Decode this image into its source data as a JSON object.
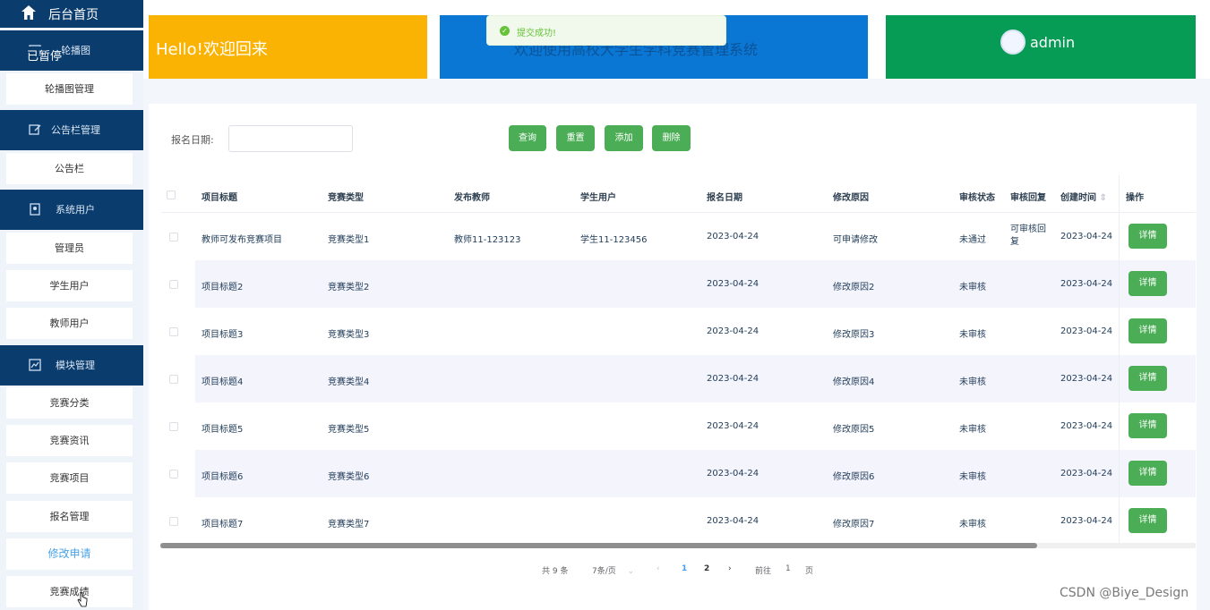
{
  "sidebar": {
    "home_label": "后台首页",
    "paused_label": "已暂停",
    "sections": [
      {
        "label": "轮播图",
        "icon": "image-icon"
      },
      {
        "label": "公告栏管理",
        "icon": "edit-icon"
      },
      {
        "label": "系统用户",
        "icon": "user-card-icon"
      },
      {
        "label": "模块管理",
        "icon": "chart-icon"
      }
    ],
    "items": [
      "轮播图管理",
      "公告栏",
      "管理员",
      "学生用户",
      "教师用户",
      "竞赛分类",
      "竞赛资讯",
      "竞赛项目",
      "报名管理",
      "修改申请",
      "竞赛成绩"
    ]
  },
  "banners": {
    "hello": "Hello!欢迎回来",
    "title": "欢迎使用高校大学生学科竞赛管理系统",
    "user": "admin"
  },
  "toast": {
    "text": "提交成功!",
    "icon": "check-circle-icon"
  },
  "search": {
    "label": "报名日期:",
    "value": "",
    "buttons": [
      "查询",
      "重置",
      "添加",
      "删除"
    ]
  },
  "table": {
    "headers": [
      "项目标题",
      "竞赛类型",
      "发布教师",
      "学生用户",
      "报名日期",
      "修改原因",
      "审核状态",
      "审核回复",
      "创建时间",
      "操作"
    ],
    "rows": [
      [
        "教师可发布竞赛项目",
        "竞赛类型1",
        "教师11-123123",
        "学生11-123456",
        "2023-04-24",
        "可申请修改",
        "未通过",
        "可审核回复",
        "2023-04-24"
      ],
      [
        "项目标题2",
        "竞赛类型2",
        "",
        "",
        "2023-04-24",
        "修改原因2",
        "未审核",
        "",
        "2023-04-24"
      ],
      [
        "项目标题3",
        "竞赛类型3",
        "",
        "",
        "2023-04-24",
        "修改原因3",
        "未审核",
        "",
        "2023-04-24"
      ],
      [
        "项目标题4",
        "竞赛类型4",
        "",
        "",
        "2023-04-24",
        "修改原因4",
        "未审核",
        "",
        "2023-04-24"
      ],
      [
        "项目标题5",
        "竞赛类型5",
        "",
        "",
        "2023-04-24",
        "修改原因5",
        "未审核",
        "",
        "2023-04-24"
      ],
      [
        "项目标题6",
        "竞赛类型6",
        "",
        "",
        "2023-04-24",
        "修改原因6",
        "未审核",
        "",
        "2023-04-24"
      ],
      [
        "项目标题7",
        "竞赛类型7",
        "",
        "",
        "2023-04-24",
        "修改原因7",
        "未审核",
        "",
        "2023-04-24"
      ]
    ],
    "detail_label": "详情"
  },
  "pagination": {
    "total": "共 9 条",
    "page_size": "7条/页",
    "pages": [
      "1",
      "2"
    ],
    "current": "1",
    "goto_prefix": "前往",
    "goto_value": "1",
    "goto_suffix": "页"
  },
  "watermark": "CSDN @Biye_Design",
  "colors": {
    "accent": "#4bad55",
    "sidebar": "#0b3c6e",
    "hello": "#fbb303",
    "title": "#0b77d4",
    "admin": "#079c55"
  }
}
